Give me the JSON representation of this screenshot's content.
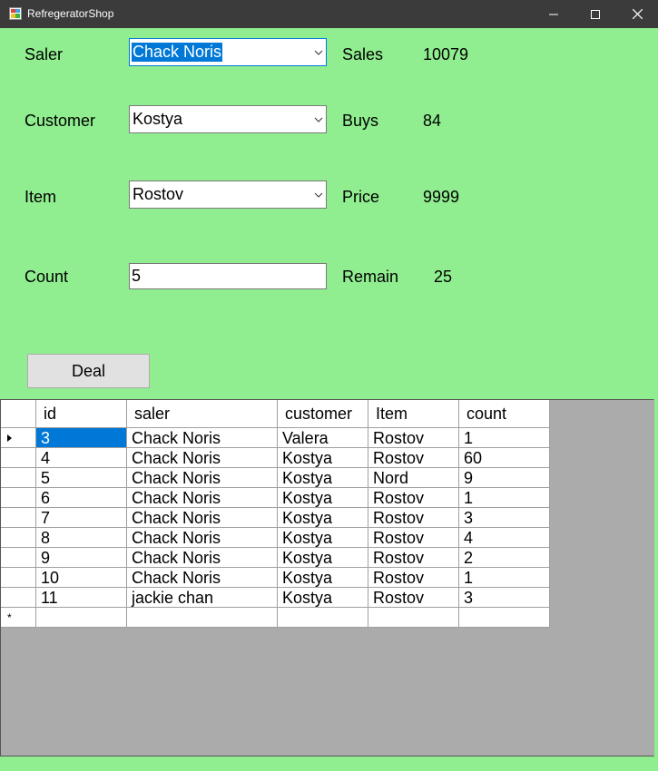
{
  "window": {
    "title": "RefregeratorShop",
    "minimize_glyph": "—",
    "maximize_glyph": "☐",
    "close_glyph": "✕"
  },
  "form": {
    "saler_label": "Saler",
    "saler_value": "Chack Noris",
    "sales_label": "Sales",
    "sales_value": "10079",
    "customer_label": "Customer",
    "customer_value": "Kostya",
    "buys_label": "Buys",
    "buys_value": "84",
    "item_label": "Item",
    "item_value": "Rostov",
    "price_label": "Price",
    "price_value": "9999",
    "count_label": "Count",
    "count_value": "5",
    "remain_label": "Remain",
    "remain_value": "25",
    "deal_label": "Deal"
  },
  "grid": {
    "columns": [
      "id",
      "saler",
      "customer",
      "Item",
      "count"
    ],
    "rows": [
      [
        "3",
        "Chack Noris",
        "Valera",
        "Rostov",
        "1"
      ],
      [
        "4",
        "Chack Noris",
        "Kostya",
        "Rostov",
        "60"
      ],
      [
        "5",
        "Chack Noris",
        "Kostya",
        "Nord",
        "9"
      ],
      [
        "6",
        "Chack Noris",
        "Kostya",
        "Rostov",
        "1"
      ],
      [
        "7",
        "Chack Noris",
        "Kostya",
        "Rostov",
        "3"
      ],
      [
        "8",
        "Chack Noris",
        "Kostya",
        "Rostov",
        "4"
      ],
      [
        "9",
        "Chack Noris",
        "Kostya",
        "Rostov",
        "2"
      ],
      [
        "10",
        "Chack Noris",
        "Kostya",
        "Rostov",
        "1"
      ],
      [
        "11",
        "jackie chan",
        "Kostya",
        "Rostov",
        "3"
      ]
    ],
    "new_row_marker": "*"
  },
  "colors": {
    "background": "#90ee90",
    "titlebar": "#3b3b3b",
    "selection": "#0078d7",
    "grid_bg": "#ababab"
  }
}
